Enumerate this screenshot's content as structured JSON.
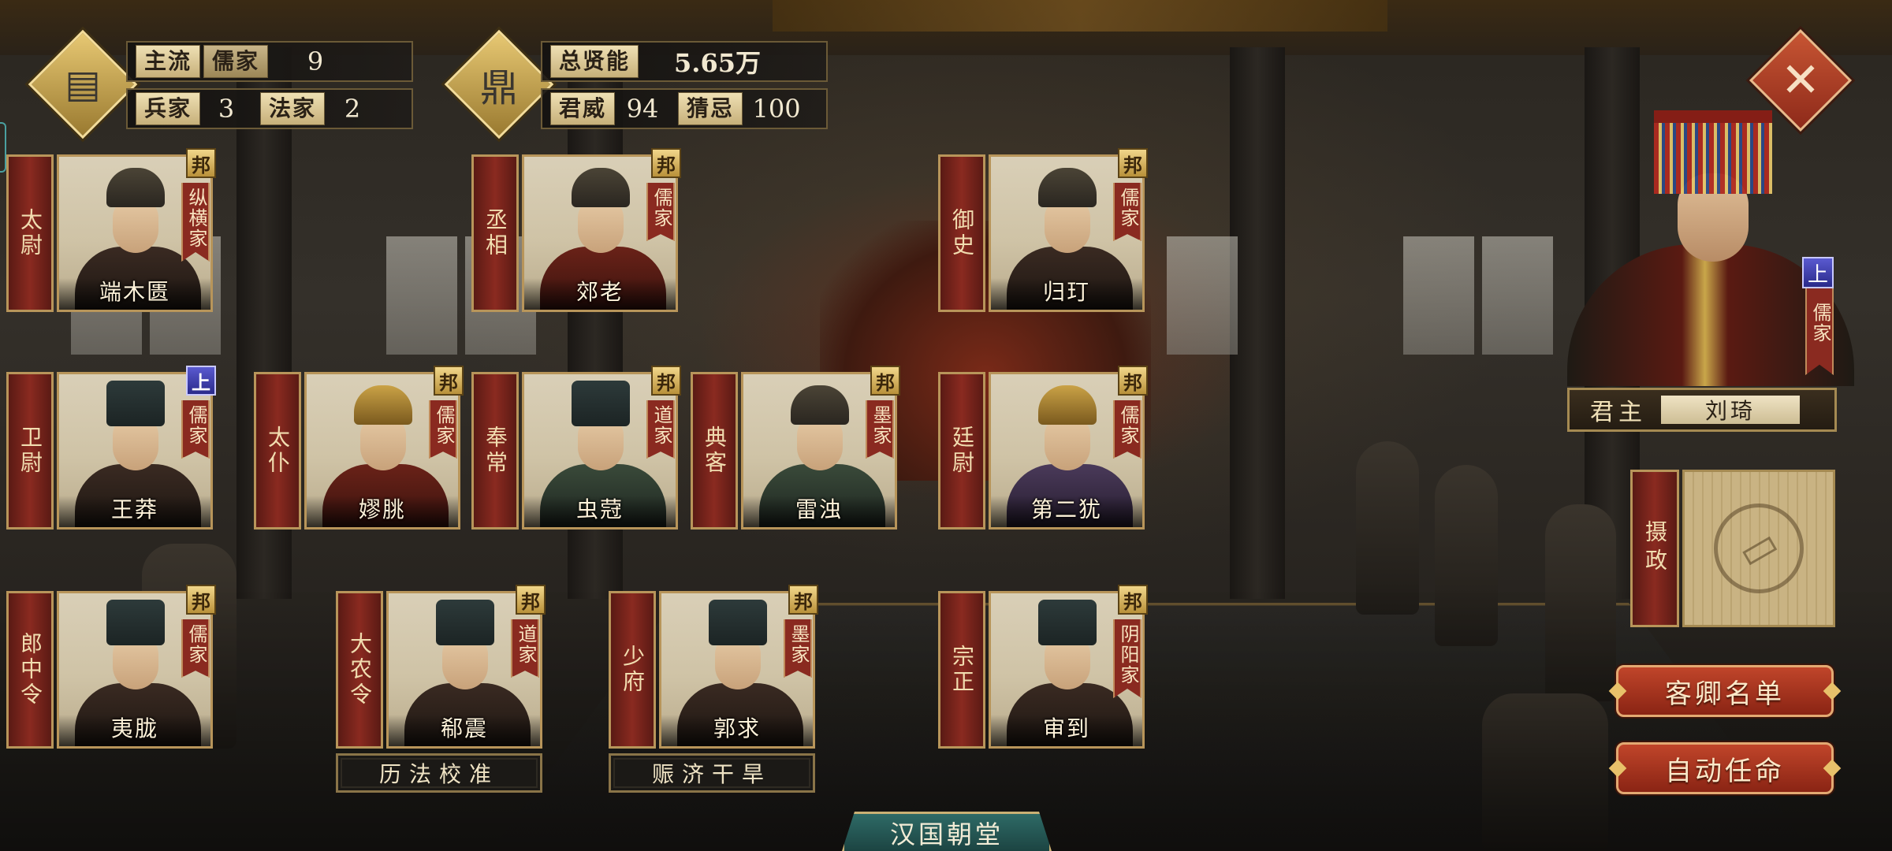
{
  "stats": {
    "mainstream_label": "主流",
    "mainstream_school": "儒家",
    "mainstream_value": "9",
    "military_label": "兵家",
    "military_value": "3",
    "legalist_label": "法家",
    "legalist_value": "2",
    "talent_label": "总贤能",
    "talent_value": "5.65万",
    "prestige_label": "君威",
    "prestige_value": "94",
    "suspicion_label": "猜忌",
    "suspicion_value": "100"
  },
  "officials": [
    {
      "title": "太尉",
      "name": "端木匮",
      "school": "纵横家",
      "badge": "邦"
    },
    {
      "title": "丞相",
      "name": "郊老",
      "school": "儒家",
      "badge": "邦"
    },
    {
      "title": "御史",
      "name": "归玎",
      "school": "儒家",
      "badge": "邦"
    },
    {
      "title": "卫尉",
      "name": "王莽",
      "school": "儒家",
      "badge": "上"
    },
    {
      "title": "太仆",
      "name": "嫪朓",
      "school": "儒家",
      "badge": "邦"
    },
    {
      "title": "奉常",
      "name": "虫蒄",
      "school": "道家",
      "badge": "邦"
    },
    {
      "title": "典客",
      "name": "雷浊",
      "school": "墨家",
      "badge": "邦"
    },
    {
      "title": "廷尉",
      "name": "第二犹",
      "school": "儒家",
      "badge": "邦"
    },
    {
      "title": "郎中令",
      "name": "夷胧",
      "school": "儒家",
      "badge": "邦"
    },
    {
      "title": "大农令",
      "name": "郗震",
      "school": "道家",
      "badge": "邦"
    },
    {
      "title": "少府",
      "name": "郭求",
      "school": "墨家",
      "badge": "邦"
    },
    {
      "title": "宗正",
      "name": "审到",
      "school": "阴阳家",
      "badge": "邦"
    }
  ],
  "policies": {
    "left": "历法校准",
    "right": "赈济干旱"
  },
  "ruler": {
    "role": "君主",
    "name": "刘琦",
    "school": "儒家",
    "badge": "上"
  },
  "regent": {
    "label": "摄政"
  },
  "buttons": {
    "guests": "客卿名单",
    "auto_appoint": "自动任命"
  },
  "court_title": "汉国朝堂",
  "colors": {
    "accent_red": "#8a2a20",
    "gold": "#c9a64a",
    "teal": "#2e6a66"
  }
}
